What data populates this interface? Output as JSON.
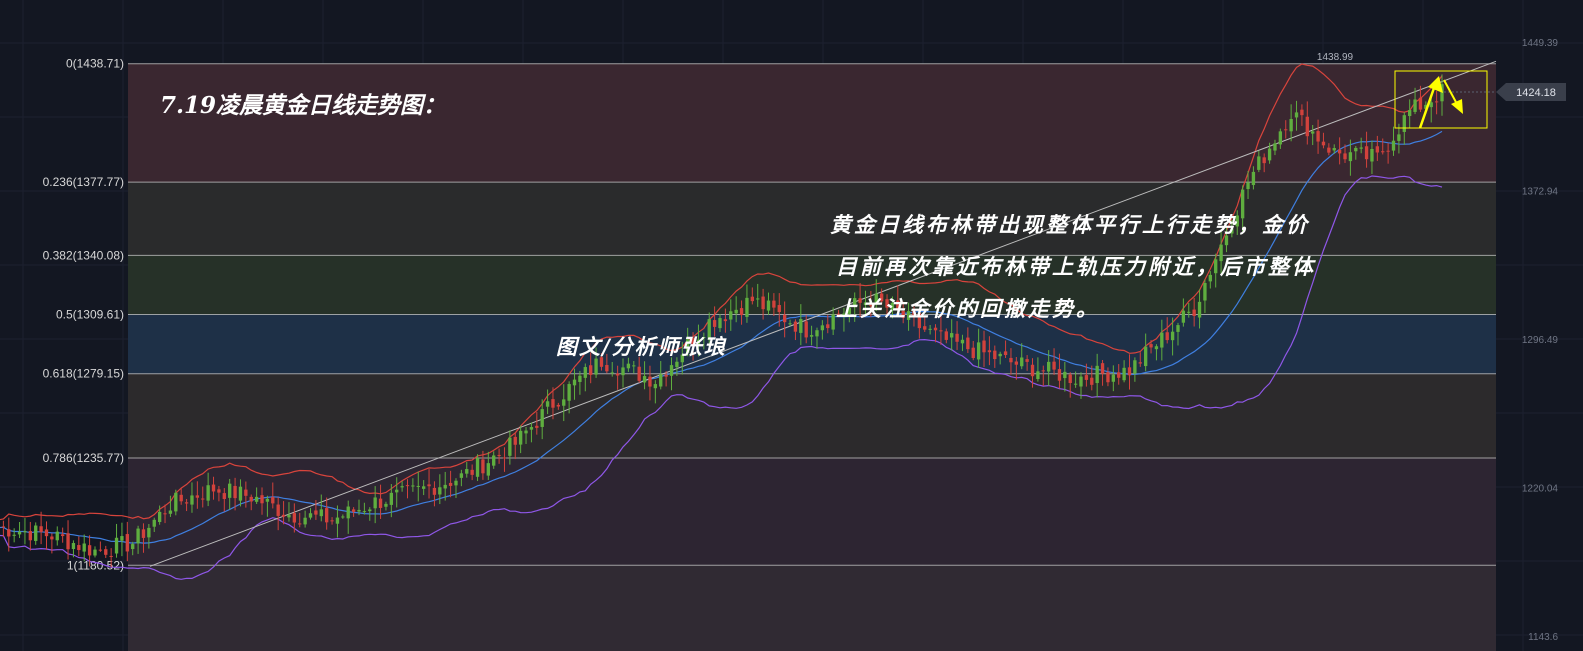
{
  "chart_data": {
    "type": "candlestick",
    "title": "7.19凌晨黄金日线走势图：",
    "annotation_lines": [
      "黄金日线布林带出现整体平行上行走势，金价",
      "目前再次靠近布林带上轨压力附近，后市整体",
      "上关注金价的回撤走势。"
    ],
    "author": "图文/分析师张琅",
    "y_range": [
      1143.6,
      1458
    ],
    "price_ticks": [
      {
        "value": 1449.39,
        "label": "1449.39"
      },
      {
        "value": 1372.94,
        "label": "1372.94"
      },
      {
        "value": 1296.49,
        "label": "1296.49"
      },
      {
        "value": 1220.04,
        "label": "1220.04"
      },
      {
        "value": 1143.6,
        "label": "1143.6"
      }
    ],
    "fib_levels": [
      {
        "ratio": 0,
        "price": 1438.71,
        "label": "0(1438.71)"
      },
      {
        "ratio": 0.236,
        "price": 1377.77,
        "label": "0.236(1377.77)"
      },
      {
        "ratio": 0.382,
        "price": 1340.08,
        "label": "0.382(1340.08)"
      },
      {
        "ratio": 0.5,
        "price": 1309.61,
        "label": "0.5(1309.61)"
      },
      {
        "ratio": 0.618,
        "price": 1279.15,
        "label": "0.618(1279.15)"
      },
      {
        "ratio": 0.786,
        "price": 1235.77,
        "label": "0.786(1235.77)"
      },
      {
        "ratio": 1,
        "price": 1180.52,
        "label": "1(1180.52)"
      }
    ],
    "fib_band_colors": [
      "#3a2730",
      "#2a2b2c",
      "#263128",
      "#1e3047",
      "#2c2a2c",
      "#2d2532",
      "#302a33"
    ],
    "high_label": {
      "value": 1438.99,
      "label": "1438.99"
    },
    "current_price": {
      "value": 1424.18,
      "label": "1424.18"
    },
    "anchors": [
      [
        0,
        1200
      ],
      [
        10,
        1196
      ],
      [
        18,
        1188
      ],
      [
        25,
        1192
      ],
      [
        32,
        1212
      ],
      [
        40,
        1220
      ],
      [
        47,
        1216
      ],
      [
        54,
        1207
      ],
      [
        62,
        1204
      ],
      [
        70,
        1213
      ],
      [
        77,
        1218
      ],
      [
        86,
        1226
      ],
      [
        96,
        1243
      ],
      [
        104,
        1267
      ],
      [
        112,
        1286
      ],
      [
        122,
        1276
      ],
      [
        132,
        1306
      ],
      [
        140,
        1317
      ],
      [
        150,
        1302
      ],
      [
        162,
        1318
      ],
      [
        175,
        1297
      ],
      [
        188,
        1285
      ],
      [
        200,
        1277
      ],
      [
        210,
        1281
      ],
      [
        222,
        1313
      ],
      [
        232,
        1378
      ],
      [
        240,
        1414
      ],
      [
        248,
        1393
      ],
      [
        256,
        1390
      ],
      [
        262,
        1414
      ],
      [
        268,
        1424
      ]
    ],
    "colors": {
      "up": "#5fae3f",
      "down": "#d2423c",
      "bb_upper": "#d8443c",
      "bb_mid": "#3f7fe0",
      "bb_lower": "#8f57e8",
      "trendline": "#bdbdbd",
      "fib_line": "#c9c9c9",
      "arrow_up": "#ffff00",
      "arrow_down": "#ffff00",
      "box": "#ffff00"
    }
  }
}
